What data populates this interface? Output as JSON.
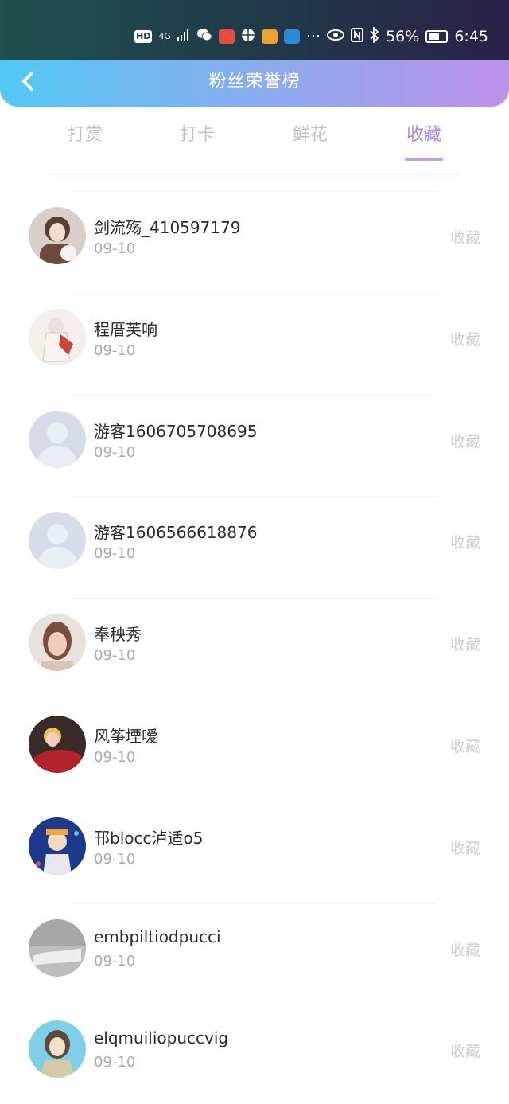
{
  "status": {
    "hd": "HD",
    "network": "4G",
    "battery": "56%",
    "time": "6:45",
    "more": "···"
  },
  "header": {
    "title": "粉丝荣誉榜",
    "back_icon": "chevron-left-icon"
  },
  "tabs": [
    {
      "label": "打赏",
      "active": false
    },
    {
      "label": "打卡",
      "active": false
    },
    {
      "label": "鲜花",
      "active": false
    },
    {
      "label": "收藏",
      "active": true
    }
  ],
  "fans": [
    {
      "name": "剑流殇_410597179",
      "date": "09-10",
      "action": "收藏",
      "avatar": "photo-avatar-1"
    },
    {
      "name": "程厝芙响",
      "date": "09-10",
      "action": "收藏",
      "avatar": "photo-avatar-2"
    },
    {
      "name": "游客1606705708695",
      "date": "09-10",
      "action": "收藏",
      "avatar": "default-avatar"
    },
    {
      "name": "游客1606566618876",
      "date": "09-10",
      "action": "收藏",
      "avatar": "default-avatar"
    },
    {
      "name": "奉秧秀",
      "date": "09-10",
      "action": "收藏",
      "avatar": "photo-avatar-5"
    },
    {
      "name": "风筝堙嗳",
      "date": "09-10",
      "action": "收藏",
      "avatar": "photo-avatar-6"
    },
    {
      "name": "邗blocc泸适o5",
      "date": "09-10",
      "action": "收藏",
      "avatar": "photo-avatar-7"
    },
    {
      "name": "embpiltiodpucci",
      "date": "09-10",
      "action": "收藏",
      "avatar": "photo-avatar-8"
    },
    {
      "name": "elqmuiliopuccvig",
      "date": "09-10",
      "action": "收藏",
      "avatar": "photo-avatar-9"
    }
  ],
  "colors": {
    "accent": "#b48ae0",
    "header_start": "#52c9f3",
    "header_end": "#bd91ea"
  }
}
